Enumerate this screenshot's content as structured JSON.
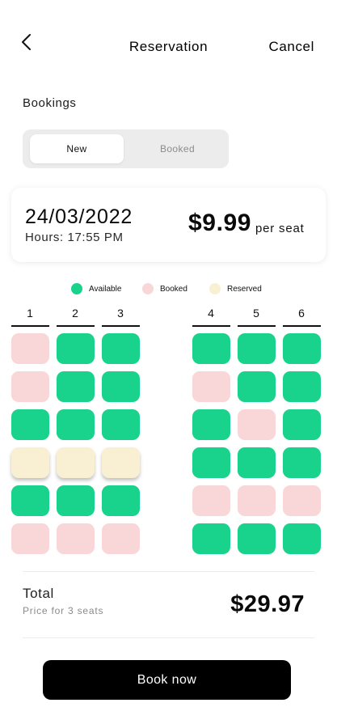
{
  "header": {
    "back_icon": "chevron-left-icon",
    "title": "Reservation",
    "cancel_label": "Cancel"
  },
  "bookings": {
    "label": "Bookings",
    "tabs": [
      {
        "label": "New",
        "selected": true
      },
      {
        "label": "Booked",
        "selected": false
      }
    ]
  },
  "session": {
    "date": "24/03/2022",
    "hours": "Hours: 17:55 PM",
    "price": "$9.99",
    "price_unit": "per seat"
  },
  "legend": [
    {
      "label": "Available",
      "color": "#19d38c"
    },
    {
      "label": "Booked",
      "color": "#f9d6d8"
    },
    {
      "label": "Reserved",
      "color": "#f9efd2"
    }
  ],
  "seat_map": {
    "columns": [
      "1",
      "2",
      "3",
      "4",
      "5",
      "6"
    ],
    "rows": [
      [
        "booked",
        "available",
        "available",
        "available",
        "available",
        "available"
      ],
      [
        "booked",
        "available",
        "available",
        "booked",
        "available",
        "available"
      ],
      [
        "available",
        "available",
        "available",
        "available",
        "booked",
        "available"
      ],
      [
        "reserved",
        "reserved",
        "reserved",
        "available",
        "available",
        "available"
      ],
      [
        "available",
        "available",
        "available",
        "booked",
        "booked",
        "booked"
      ],
      [
        "booked",
        "booked",
        "booked",
        "available",
        "available",
        "available"
      ]
    ]
  },
  "summary": {
    "total_label": "Total",
    "subtitle": "Price for 3 seats",
    "total_price": "$29.97"
  },
  "actions": {
    "book_label": "Book now"
  }
}
